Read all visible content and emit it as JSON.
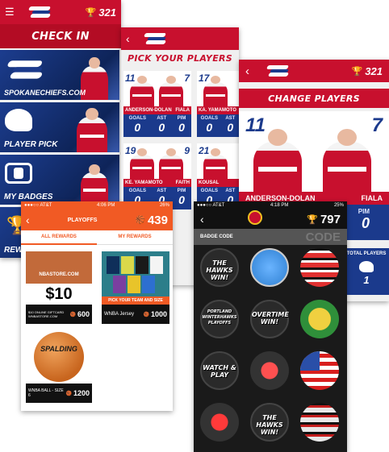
{
  "colors": {
    "spokane_red": "#c8102e",
    "spokane_blue": "#1b3a8c",
    "wnba_orange": "#f15a24",
    "hawks_dark": "#1a1a1a"
  },
  "checkin": {
    "menu_icon": "hamburger-icon",
    "points": "321",
    "title": "CHECK IN",
    "tiles": [
      {
        "label": "SPOKANECHIEFS.COM"
      },
      {
        "label": "PLAYER PICK"
      },
      {
        "label": "MY BADGES"
      },
      {
        "label": "REW"
      }
    ]
  },
  "pick": {
    "points": "321",
    "title": "PICK YOUR PLAYERS",
    "cards": [
      {
        "num_left": "11",
        "num_right": "7",
        "name_left": "ANDERSON-DOLAN",
        "name_right": "FIALA",
        "stats": [
          "GOALS",
          "AST",
          "PIM"
        ],
        "values": [
          "0",
          "0",
          "0"
        ]
      },
      {
        "num_left": "17",
        "num_right": "",
        "name_left": "KA. YAMAMOTO",
        "name_right": "",
        "stats": [
          "GOALS",
          "AST",
          "PIM"
        ],
        "values": [
          "0",
          "0",
          "0"
        ]
      },
      {
        "num_left": "19",
        "num_right": "9",
        "name_left": "KE. YAMAMOTO",
        "name_right": "FAITH",
        "stats": [
          "GOALS",
          "AST",
          "PIM"
        ],
        "values": [
          "0",
          "0",
          "0"
        ]
      },
      {
        "num_left": "21",
        "num_right": "",
        "name_left": "KOUSAL",
        "name_right": "",
        "stats": [
          "GOALS",
          "AST"
        ],
        "values": [
          "0",
          "0"
        ]
      }
    ]
  },
  "change": {
    "points": "321",
    "title": "CHANGE PLAYERS",
    "num_left": "11",
    "num_right": "7",
    "name_left": "ANDERSON-DOLAN",
    "name_right": "FIALA",
    "pim_label": "PIM",
    "pim_value": "0",
    "total_label": "TOTAL PLAYERS",
    "total_value": "1"
  },
  "wnba": {
    "status": {
      "carrier": "●●●○○ AT&T",
      "time": "4:06 PM",
      "battery": "26%"
    },
    "logo_text": "PLAYOFFS",
    "points": "439",
    "tabs": [
      "ALL REWARDS",
      "MY REWARDS"
    ],
    "rewards": [
      {
        "image_text": "NBASTORE.COM",
        "price": "$10",
        "desc": "$10 ONLINE GIFTCARD WNBASTORE.COM",
        "cost": "600"
      },
      {
        "image_text": "PICK YOUR TEAM AND SIZE",
        "desc": "WNBA Jersey",
        "cost": "1000"
      },
      {
        "image_text": "SPALDING",
        "desc": "WNBA BALL - SIZE 6",
        "cost": "1200"
      }
    ]
  },
  "hawks": {
    "status": {
      "carrier": "●●●○○ AT&T",
      "time": "4:18 PM",
      "battery": "25%"
    },
    "points": "797",
    "code_label": "BADGE CODE",
    "code_watermark": "CODE",
    "badges": [
      {
        "text": "THE HAWKS WIN!",
        "color": "#2a2a2a"
      },
      {
        "text": "",
        "color": "#2e7fd1"
      },
      {
        "text": "",
        "color": "#e03030"
      },
      {
        "text": "PORTLAND WINTERHAWKS PLAYOFFS",
        "color": "#2a2a2a"
      },
      {
        "text": "OVERTIME WIN!",
        "color": "#2a2a2a"
      },
      {
        "text": "",
        "color": "#2f8f3a"
      },
      {
        "text": "WATCH & PLAY",
        "color": "#2a2a2a"
      },
      {
        "text": "",
        "color": "#d81e1e"
      },
      {
        "text": "",
        "color": "#2a4fa8"
      },
      {
        "text": "",
        "color": "#c41e1e"
      },
      {
        "text": "THE HAWKS WIN!",
        "color": "#2a2a2a"
      },
      {
        "text": "",
        "color": "#e8e8e8"
      }
    ]
  }
}
